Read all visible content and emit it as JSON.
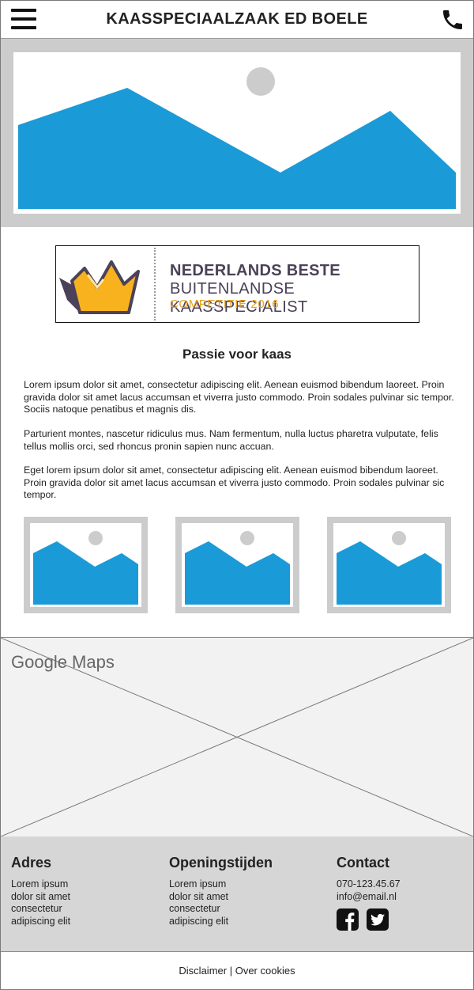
{
  "header": {
    "title": "KAASSPECIAALZAAK ED BOELE",
    "menu_icon": "hamburger-menu-icon",
    "phone_icon": "phone-icon"
  },
  "hero": {
    "image": "image-placeholder"
  },
  "award": {
    "line1": "NEDERLANDS BESTE",
    "line2": "BUITENLANDSE KAASSPECIALIST",
    "line3": "COMPETITIE 2016"
  },
  "intro": {
    "heading": "Passie voor kaas",
    "paragraphs": [
      "Lorem ipsum dolor sit amet, consectetur adipiscing elit. Aenean euismod bibendum laoreet. Proin gravida dolor sit amet lacus accumsan et viverra justo commodo. Proin sodales pulvinar sic tempor. Sociis natoque penatibus et magnis dis.",
      "Parturient montes, nascetur ridiculus mus. Nam fermentum, nulla luctus pharetra vulputate, felis tellus mollis orci, sed rhoncus pronin sapien nunc accuan.",
      "Eget lorem ipsum dolor sit amet, consectetur adipiscing elit. Aenean euismod bibendum laoreet. Proin gravida dolor sit amet lacus accumsan et viverra justo commodo. Proin sodales pulvinar sic tempor."
    ]
  },
  "map": {
    "label": "Google Maps"
  },
  "footer": {
    "address": {
      "title": "Adres",
      "lines": [
        "Lorem ipsum",
        "dolor sit amet",
        "consectetur",
        "adipiscing elit"
      ]
    },
    "hours": {
      "title": "Openingstijden",
      "lines": [
        "Lorem ipsum",
        "dolor sit amet",
        "consectetur",
        "adipiscing elit"
      ]
    },
    "contact": {
      "title": "Contact",
      "phone": "070-123.45.67",
      "email": "info@email.nl",
      "social": [
        "facebook-icon",
        "twitter-icon"
      ]
    }
  },
  "legal": {
    "disclaimer": "Disclaimer",
    "separator": "|",
    "cookies": "Over cookies"
  },
  "colors": {
    "placeholder_blue": "#1a9bd7",
    "frame_gray": "#cccccc",
    "footer_gray": "#d6d6d6",
    "map_bg": "#f2f2f2"
  }
}
